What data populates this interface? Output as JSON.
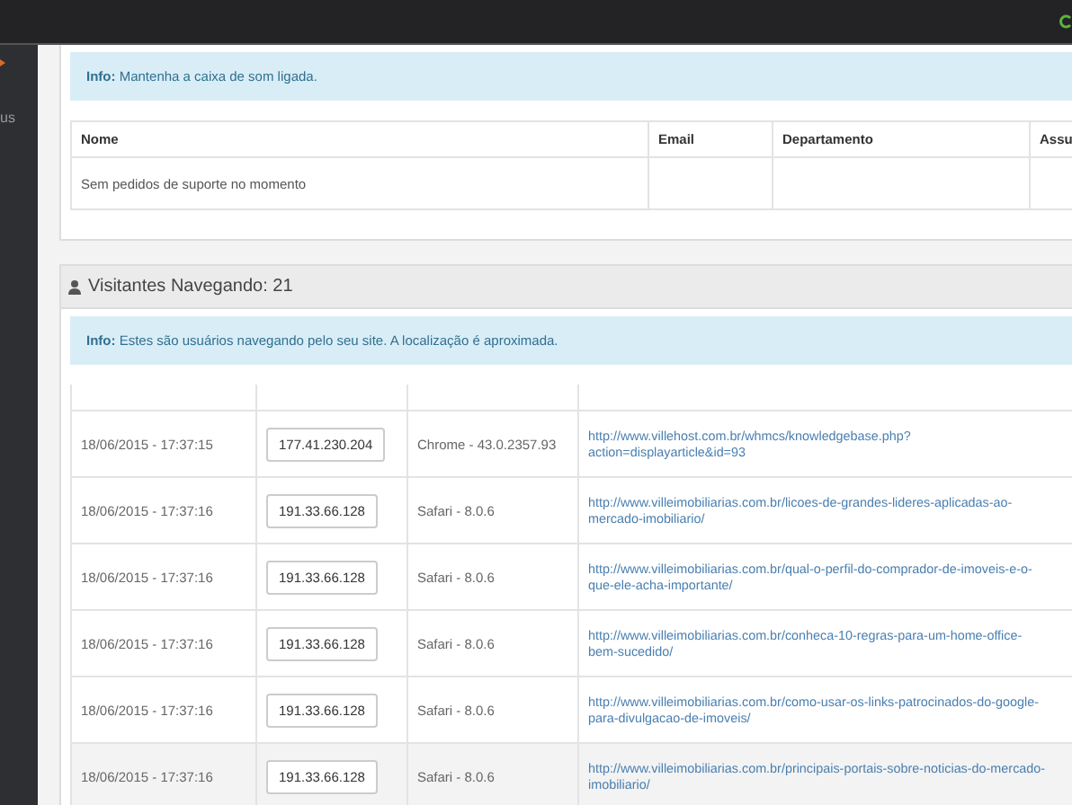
{
  "sidebar": {
    "items": [
      {
        "label": "us"
      }
    ]
  },
  "support_panel": {
    "info": {
      "label": "Info:",
      "text": "Mantenha a caixa de som ligada."
    },
    "table": {
      "columns": [
        "Nome",
        "Email",
        "Departamento",
        "Assu"
      ],
      "empty_message": "Sem pedidos de suporte no momento"
    }
  },
  "visitors_panel": {
    "title": "Visitantes Navegando: 21",
    "info": {
      "label": "Info:",
      "text": "Estes são usuários navegando pelo seu site. A localização é aproximada."
    },
    "rows": [
      {
        "time": "18/06/2015 - 17:37:15",
        "ip": "177.41.230.204",
        "browser": "Chrome - 43.0.2357.93",
        "url": "http://www.villehost.com.br/whmcs/knowledgebase.php?action=displayarticle&id=93",
        "highlighted": false
      },
      {
        "time": "18/06/2015 - 17:37:16",
        "ip": "191.33.66.128",
        "browser": "Safari - 8.0.6",
        "url": "http://www.villeimobiliarias.com.br/licoes-de-grandes-lideres-aplicadas-ao-mercado-imobiliario/",
        "highlighted": false
      },
      {
        "time": "18/06/2015 - 17:37:16",
        "ip": "191.33.66.128",
        "browser": "Safari - 8.0.6",
        "url": "http://www.villeimobiliarias.com.br/qual-o-perfil-do-comprador-de-imoveis-e-o-que-ele-acha-importante/",
        "highlighted": false
      },
      {
        "time": "18/06/2015 - 17:37:16",
        "ip": "191.33.66.128",
        "browser": "Safari - 8.0.6",
        "url": "http://www.villeimobiliarias.com.br/conheca-10-regras-para-um-home-office-bem-sucedido/",
        "highlighted": false
      },
      {
        "time": "18/06/2015 - 17:37:16",
        "ip": "191.33.66.128",
        "browser": "Safari - 8.0.6",
        "url": "http://www.villeimobiliarias.com.br/como-usar-os-links-patrocinados-do-google-para-divulgacao-de-imoveis/",
        "highlighted": false
      },
      {
        "time": "18/06/2015 - 17:37:16",
        "ip": "191.33.66.128",
        "browser": "Safari - 8.0.6",
        "url": "http://www.villeimobiliarias.com.br/principais-portais-sobre-noticias-do-mercado-imobiliario/",
        "highlighted": true
      }
    ]
  }
}
